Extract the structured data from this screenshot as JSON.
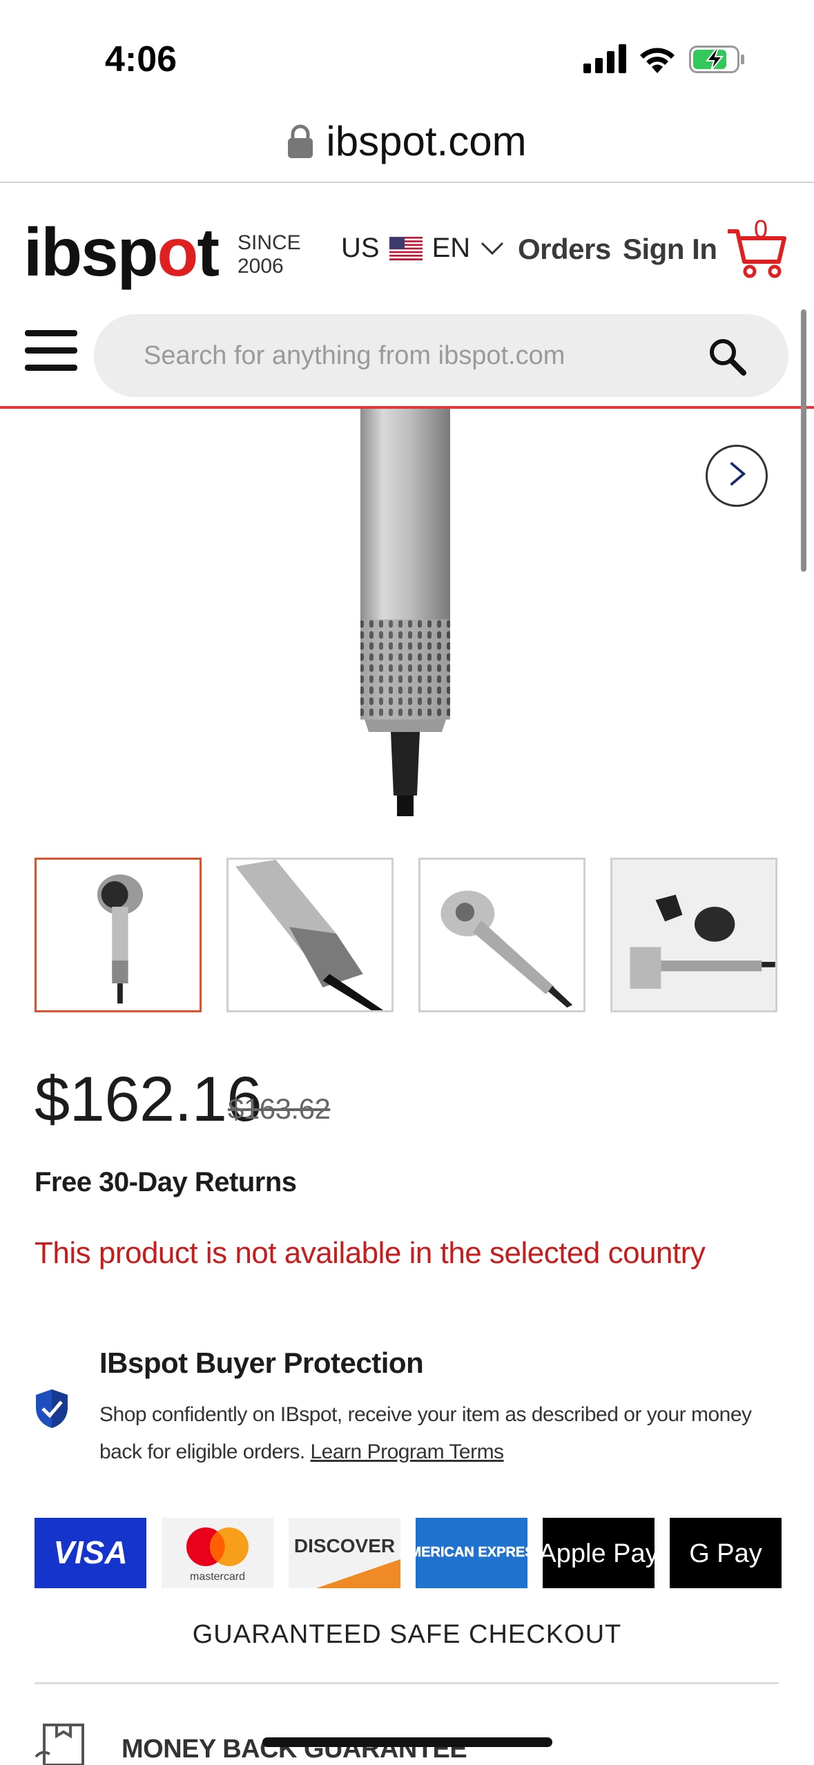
{
  "status_bar": {
    "time": "4:06"
  },
  "browser": {
    "url": "ibspot.com"
  },
  "header": {
    "logo_text_a": "ibsp",
    "logo_text_o": "o",
    "logo_text_b": "t",
    "since_line1": "SINCE",
    "since_line2": "2006",
    "country": "US",
    "language": "EN",
    "orders": "Orders",
    "sign_in": "Sign In",
    "cart_count": "0"
  },
  "search": {
    "placeholder": "Search for anything from ibspot.com"
  },
  "product": {
    "price": "$162.16",
    "old_price": "$163.62",
    "returns": "Free 30-Day Returns",
    "availability": "This product is not available in the selected country"
  },
  "protection": {
    "title": "IBspot Buyer Protection",
    "text": "Shop confidently on IBspot, receive your item as described or your money back for eligible orders. ",
    "link": "Learn Program Terms"
  },
  "payments": [
    "VISA",
    "mastercard",
    "DISCOVER",
    "AMERICAN EXPRESS",
    "Apple Pay",
    "G Pay"
  ],
  "checkout_note": "GUARANTEED SAFE CHECKOUT",
  "money_back": "MONEY BACK GUARANTEE",
  "colors": {
    "accent": "#e02020",
    "warning": "#c81b1b",
    "thumb_active": "#e0502a"
  }
}
